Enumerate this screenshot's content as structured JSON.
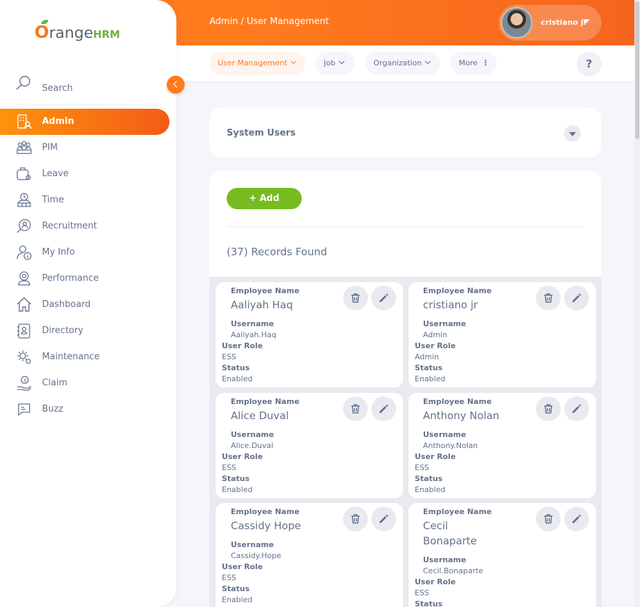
{
  "header": {
    "breadcrumb": "Admin / User Management",
    "user_name": "cristiano jr"
  },
  "subnav": {
    "items": [
      {
        "label": "User Management"
      },
      {
        "label": "Job"
      },
      {
        "label": "Organization"
      },
      {
        "label": "More"
      }
    ],
    "help": "?"
  },
  "sidebar": {
    "logo_o": "O",
    "logo_range": "range",
    "logo_hrm": "HRM",
    "search_label": "Search",
    "items": [
      {
        "label": "Admin",
        "icon": "admin-icon"
      },
      {
        "label": "PIM",
        "icon": "pim-icon"
      },
      {
        "label": "Leave",
        "icon": "leave-icon"
      },
      {
        "label": "Time",
        "icon": "time-icon"
      },
      {
        "label": "Recruitment",
        "icon": "recruitment-icon"
      },
      {
        "label": "My Info",
        "icon": "my-info-icon"
      },
      {
        "label": "Performance",
        "icon": "performance-icon"
      },
      {
        "label": "Dashboard",
        "icon": "dashboard-icon"
      },
      {
        "label": "Directory",
        "icon": "directory-icon"
      },
      {
        "label": "Maintenance",
        "icon": "maintenance-icon"
      },
      {
        "label": "Claim",
        "icon": "claim-icon"
      },
      {
        "label": "Buzz",
        "icon": "buzz-icon"
      }
    ]
  },
  "system_users": {
    "title": "System Users"
  },
  "list": {
    "add_label": "+  Add",
    "records": "(37) Records Found",
    "labels": {
      "employee_name": "Employee Name",
      "username": "Username",
      "user_role": "User Role",
      "status": "Status"
    },
    "users": [
      {
        "employee_name": "Aaliyah Haq",
        "username": "Aaliyah.Haq",
        "user_role": "ESS",
        "status": "Enabled"
      },
      {
        "employee_name": "cristiano jr",
        "username": "Admin",
        "user_role": "Admin",
        "status": "Enabled"
      },
      {
        "employee_name": "Alice Duval",
        "username": "Alice.Duval",
        "user_role": "ESS",
        "status": "Enabled"
      },
      {
        "employee_name": "Anthony Nolan",
        "username": "Anthony.Nolan",
        "user_role": "ESS",
        "status": "Enabled"
      },
      {
        "employee_name": "Cassidy Hope",
        "username": "Cassidy.Hope",
        "user_role": "ESS",
        "status": "Enabled"
      },
      {
        "employee_name_line1": "Cecil",
        "employee_name_line2": "Bonaparte",
        "username": "Cecil.Bonaparte",
        "user_role": "ESS",
        "status": ""
      }
    ]
  },
  "colors": {
    "brand_orange": "#ff7b1d",
    "add_green": "#76bc21",
    "text": "#64728c"
  }
}
